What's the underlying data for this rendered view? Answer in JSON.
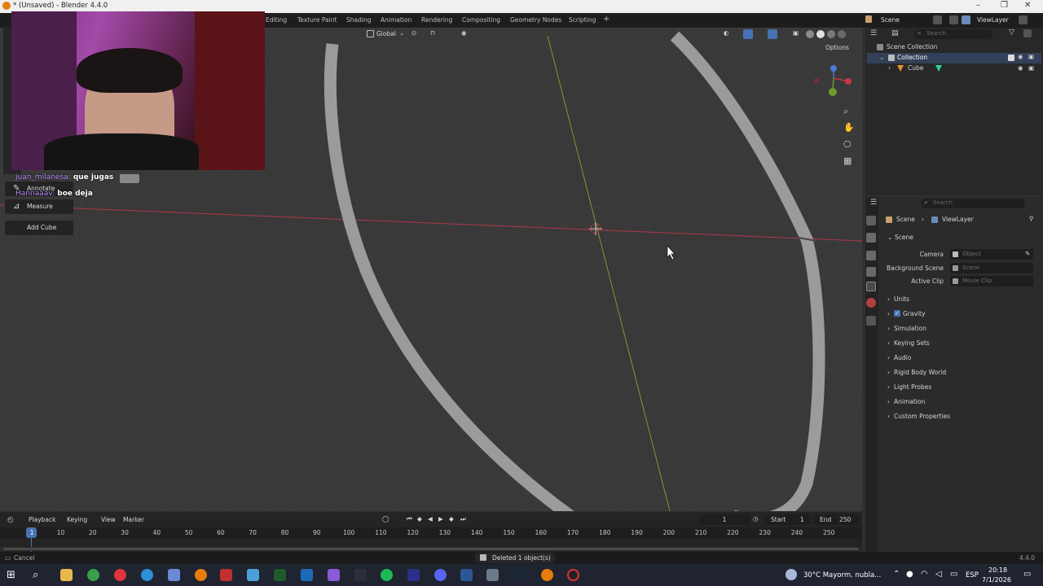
{
  "window": {
    "title": "* (Unsaved) - Blender 4.4.0",
    "minimize": "–",
    "restore": "❐",
    "close": "✕"
  },
  "workspaces": [
    "Editing",
    "Texture Paint",
    "Shading",
    "Animation",
    "Rendering",
    "Compositing",
    "Geometry Nodes",
    "Scripting"
  ],
  "add_workspace": "+",
  "top_right": {
    "scene": "Scene",
    "view_layer": "ViewLayer"
  },
  "viewport": {
    "orientation": "Global",
    "options": "Options",
    "tools": {
      "annotate": "Annotate",
      "measure": "Measure",
      "add_cube": "Add Cube"
    }
  },
  "chat": [
    {
      "user": "juan_milanesa:",
      "message": "que jugas"
    },
    {
      "user": "Hannaaav:",
      "message": "boe deja"
    }
  ],
  "outliner": {
    "search_placeholder": "Search",
    "scene_collection": "Scene Collection",
    "collection": "Collection",
    "cube": "Cube"
  },
  "properties": {
    "search_placeholder": "Search",
    "breadcrumb": {
      "scene": "Scene",
      "view_layer": "ViewLayer"
    },
    "panel_title": "Scene",
    "camera_label": "Camera",
    "camera_value": "Object",
    "background_scene_label": "Background Scene",
    "background_scene_value": "Scene",
    "active_clip_label": "Active Clip",
    "active_clip_value": "Movie Clip",
    "sections": [
      "Units",
      "Gravity",
      "Simulation",
      "Keying Sets",
      "Audio",
      "Rigid Body World",
      "Light Probes",
      "Animation",
      "Custom Properties"
    ],
    "gravity_checked": true
  },
  "timeline": {
    "menus": [
      "Playback",
      "Keying",
      "View",
      "Marker"
    ],
    "current_frame": "1",
    "start_label": "Start",
    "start_value": "1",
    "end_label": "End",
    "end_value": "250",
    "ruler": [
      "1",
      "10",
      "20",
      "30",
      "40",
      "50",
      "60",
      "70",
      "80",
      "90",
      "100",
      "110",
      "120",
      "130",
      "140",
      "150",
      "160",
      "170",
      "180",
      "190",
      "200",
      "210",
      "220",
      "230",
      "240",
      "250"
    ]
  },
  "status": {
    "left": "Cancel",
    "center": "Deleted 1 object(s)",
    "version": "4.4.0"
  },
  "taskbar": {
    "weather": "30°C  Mayorm. nubla...",
    "language": "ESP",
    "time": "20:18",
    "date": "7/1/2026"
  },
  "colors": {
    "x_axis": "#b0384a",
    "y_axis": "#7e9a2c",
    "accent": "#4772b3",
    "chat_user": "#b58cff"
  }
}
